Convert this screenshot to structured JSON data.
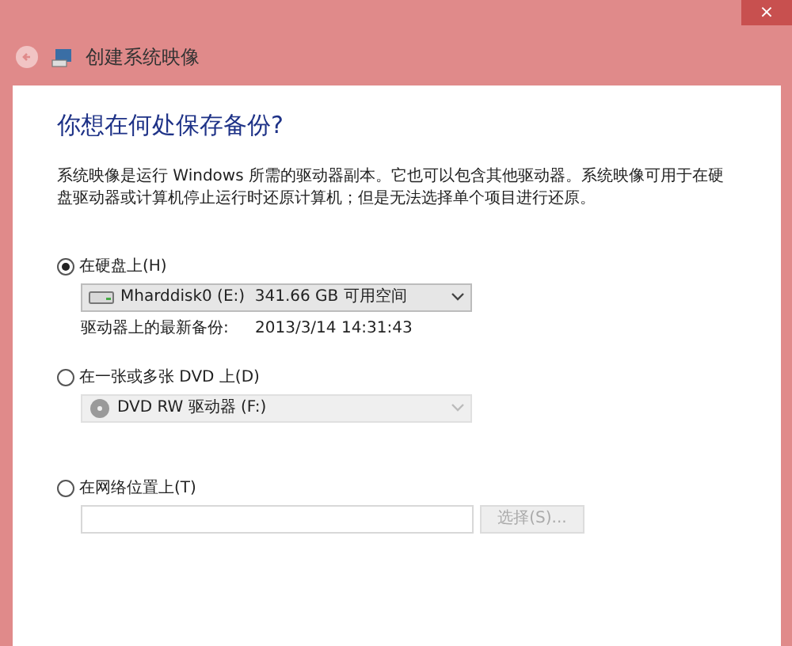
{
  "window": {
    "title": "创建系统映像",
    "close": "×"
  },
  "heading": "你想在何处保存备份?",
  "description": "系统映像是运行 Windows 所需的驱动器副本。它也可以包含其他驱动器。系统映像可用于在硬盘驱动器或计算机停止运行时还原计算机；但是无法选择单个项目进行还原。",
  "options": [
    {
      "kind": "drive",
      "label": "在硬盘上(H)",
      "selected": true,
      "dropdown": {
        "value": "Mharddisk0 (E:)  341.66 GB 可用空间",
        "disabled": false
      },
      "info_label": "驱动器上的最新备份:",
      "info_value": "2013/3/14 14:31:43"
    },
    {
      "kind": "drive",
      "label": "在一张或多张 DVD 上(D)",
      "selected": false,
      "dropdown": {
        "value": "DVD RW 驱动器 (F:)",
        "disabled": true
      }
    },
    {
      "kind": "network",
      "label": "在网络位置上(T)",
      "selected": false,
      "button": {
        "label": "选择(S)...",
        "disabled": true
      }
    }
  ]
}
